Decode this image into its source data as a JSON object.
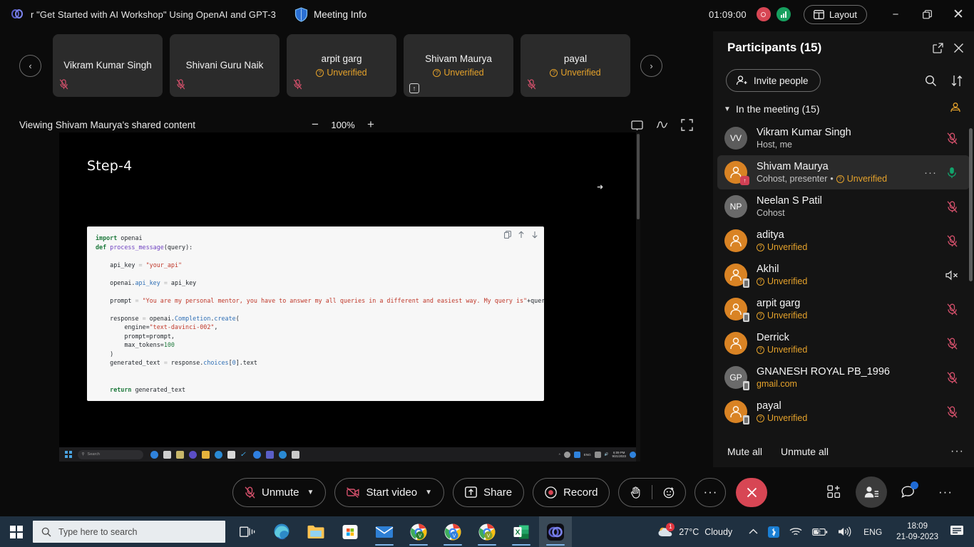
{
  "titlebar": {
    "meeting_title": "r \"Get Started with AI Workshop\" Using OpenAI and GPT-3",
    "meeting_info_label": "Meeting Info",
    "call_timer": "01:09:00",
    "layout_label": "Layout",
    "minimize_icon": "minimize-icon",
    "restore_icon": "restore-icon",
    "close_icon": "close-icon",
    "teams_logo": "teams-logo-icon",
    "shield_icon": "shield-icon",
    "recording_icon": "recording-indicator-icon",
    "network_icon": "network-quality-icon"
  },
  "thumbnails": {
    "prev_label": "‹",
    "next_label": "›",
    "unverified_label": "Unverified",
    "tiles": [
      {
        "name": "Vikram Kumar Singh",
        "unverified": false,
        "mic_off": true,
        "sharing": false
      },
      {
        "name": "Shivani Guru Naik",
        "unverified": false,
        "mic_off": true,
        "sharing": false
      },
      {
        "name": "arpit garg",
        "unverified": true,
        "mic_off": true,
        "sharing": false
      },
      {
        "name": "Shivam Maurya",
        "unverified": true,
        "mic_off": false,
        "sharing": true
      },
      {
        "name": "payal",
        "unverified": true,
        "mic_off": true,
        "sharing": false
      }
    ]
  },
  "sharebar": {
    "viewing_label": "Viewing Shivam Maurya's shared content",
    "zoom_out": "−",
    "zoom_value": "100%",
    "zoom_in": "+",
    "pop_out_icon": "pop-out-icon",
    "annotate_icon": "annotate-icon",
    "fullscreen_icon": "fullscreen-icon"
  },
  "shared_content": {
    "slide_title": "Step-4",
    "code_lines": [
      {
        "t": "kw",
        "v": "import "
      },
      {
        "t": "pl",
        "v": "openai\n"
      },
      {
        "t": "kw",
        "v": "def "
      },
      {
        "t": "fn",
        "v": "process_message"
      },
      {
        "t": "pl",
        "v": "(query):\n\n"
      },
      {
        "t": "pl",
        "v": "    api_key "
      },
      {
        "t": "op",
        "v": "= "
      },
      {
        "t": "str",
        "v": "\"your_api\"\n\n"
      },
      {
        "t": "pl",
        "v": "    openai."
      },
      {
        "t": "prop",
        "v": "api_key "
      },
      {
        "t": "op",
        "v": "= "
      },
      {
        "t": "pl",
        "v": "api_key\n\n"
      },
      {
        "t": "pl",
        "v": "    prompt "
      },
      {
        "t": "op",
        "v": "= "
      },
      {
        "t": "str",
        "v": "\"You are my personal mentor, you have to answer my all queries in a different and easiest way. My query is\""
      },
      {
        "t": "pl",
        "v": "+query\n\n"
      },
      {
        "t": "pl",
        "v": "    response "
      },
      {
        "t": "op",
        "v": "= "
      },
      {
        "t": "pl",
        "v": "openai."
      },
      {
        "t": "prop",
        "v": "Completion"
      },
      {
        "t": "pl",
        "v": "."
      },
      {
        "t": "prop",
        "v": "create"
      },
      {
        "t": "pl",
        "v": "(\n"
      },
      {
        "t": "pl",
        "v": "        engine="
      },
      {
        "t": "str",
        "v": "\"text-davinci-002\""
      },
      {
        "t": "pl",
        "v": ",\n        prompt=prompt,\n        max_tokens="
      },
      {
        "t": "num",
        "v": "100"
      },
      {
        "t": "pl",
        "v": "\n    )\n"
      },
      {
        "t": "pl",
        "v": "    generated_text "
      },
      {
        "t": "op",
        "v": "= "
      },
      {
        "t": "pl",
        "v": "response."
      },
      {
        "t": "prop",
        "v": "choices"
      },
      {
        "t": "pl",
        "v": "["
      },
      {
        "t": "prop",
        "v": "0"
      },
      {
        "t": "pl",
        "v": "].text\n\n\n"
      },
      {
        "t": "kw",
        "v": "    return "
      },
      {
        "t": "pl",
        "v": "generated_text"
      }
    ],
    "copy_icon": "copy-icon",
    "scroll_up_icon": "arrow-up-icon",
    "scroll_down_icon": "arrow-down-icon",
    "inner_taskbar": {
      "search_placeholder": "Search",
      "clock": "6:09 PM",
      "date": "9/21/2023"
    }
  },
  "participants": {
    "title": "Participants (15)",
    "open_in_new_icon": "pop-out-icon",
    "close_icon": "close-icon",
    "invite_label": "Invite people",
    "invite_icon": "add-person-icon",
    "search_icon": "search-icon",
    "sort_icon": "sort-icon",
    "section_label": "In the meeting (15)",
    "section_chevron": "chevron-down-icon",
    "section_icon": "lobby-people-icon",
    "unverified_label": "Unverified",
    "list": [
      {
        "name": "Vikram Kumar Singh",
        "meta": "Host, me",
        "initials": "VV",
        "avatar": "initials",
        "avatar_color": "#5c5c5c",
        "unverified": false,
        "status": "mic-off",
        "badge": "none",
        "active": false
      },
      {
        "name": "Shivam Maurya",
        "meta": "Cohost, presenter",
        "initials": "",
        "avatar": "person",
        "avatar_color": "#d98324",
        "unverified": true,
        "status": "mic-on",
        "badge": "share",
        "active": true
      },
      {
        "name": "Neelan S Patil",
        "meta": "Cohost",
        "initials": "NP",
        "avatar": "initials",
        "avatar_color": "#6a6a6a",
        "unverified": false,
        "status": "mic-off",
        "badge": "none",
        "active": false
      },
      {
        "name": "aditya",
        "meta": "",
        "initials": "",
        "avatar": "person",
        "avatar_color": "#d98324",
        "unverified": true,
        "status": "mic-off",
        "badge": "none",
        "active": false
      },
      {
        "name": "Akhil",
        "meta": "",
        "initials": "",
        "avatar": "person",
        "avatar_color": "#d98324",
        "unverified": true,
        "status": "speaker-off",
        "badge": "phone",
        "active": false
      },
      {
        "name": "arpit garg",
        "meta": "",
        "initials": "",
        "avatar": "person",
        "avatar_color": "#d98324",
        "unverified": true,
        "status": "mic-off",
        "badge": "phone",
        "active": false
      },
      {
        "name": "Derrick",
        "meta": "",
        "initials": "",
        "avatar": "person",
        "avatar_color": "#d98324",
        "unverified": true,
        "status": "mic-off",
        "badge": "none",
        "active": false
      },
      {
        "name": "GNANESH ROYAL PB_1996",
        "meta": "gmail.com",
        "initials": "GP",
        "avatar": "initials",
        "avatar_color": "#6a6a6a",
        "unverified": false,
        "status": "mic-off",
        "badge": "phone",
        "active": false,
        "meta_is_domain": true
      },
      {
        "name": "payal",
        "meta": "",
        "initials": "",
        "avatar": "person",
        "avatar_color": "#d98324",
        "unverified": true,
        "status": "mic-off",
        "badge": "phone",
        "active": false
      }
    ],
    "mute_all_label": "Mute all",
    "unmute_all_label": "Unmute all",
    "more_label": "···"
  },
  "controls": {
    "unmute_label": "Unmute",
    "unmute_icon": "mic-off-icon",
    "start_video_label": "Start video",
    "start_video_icon": "camera-off-icon",
    "share_label": "Share",
    "share_icon": "share-screen-icon",
    "record_label": "Record",
    "record_icon": "record-icon",
    "raise_hand_icon": "raise-hand-icon",
    "reactions_icon": "reaction-icon",
    "more_label": "···",
    "hangup_icon": "end-call-icon",
    "apps_icon": "apps-add-icon",
    "people_icon": "people-icon",
    "chat_icon": "chat-icon",
    "overflow_label": "···"
  },
  "taskbar": {
    "start_icon": "windows-start-icon",
    "search_placeholder": "Type here to search",
    "search_icon": "search-icon",
    "task_view_icon": "task-view-icon",
    "apps": [
      {
        "name": "edge-icon",
        "color": "#2d8ac7",
        "selected": false,
        "open": false
      },
      {
        "name": "explorer-icon",
        "color": "#ffc452",
        "selected": false,
        "open": false
      },
      {
        "name": "store-icon",
        "color": "#ffffff",
        "selected": false,
        "open": false
      },
      {
        "name": "mail-icon",
        "color": "#2e7fd4",
        "selected": false,
        "open": true
      },
      {
        "name": "chrome-icon-1",
        "color": "#4caf50",
        "selected": false,
        "open": true
      },
      {
        "name": "chrome-icon-2",
        "color": "#2f7fe0",
        "selected": false,
        "open": true
      },
      {
        "name": "chrome-icon-3",
        "color": "#4caf50",
        "selected": false,
        "open": true
      },
      {
        "name": "excel-icon",
        "color": "#1d6f42",
        "selected": false,
        "open": true
      },
      {
        "name": "teams-icon",
        "color": "#5b5fc7",
        "selected": true,
        "open": true
      }
    ],
    "weather_temp": "27°C",
    "weather_desc": "Cloudy",
    "weather_badge": "1",
    "chevron_icon": "show-hidden-icons-icon",
    "bluetooth_icon": "bluetooth-icon",
    "wifi_icon": "wifi-icon",
    "battery_icon": "battery-charging-icon",
    "volume_icon": "volume-icon",
    "language": "ENG",
    "clock_time": "18:09",
    "clock_date": "21-09-2023",
    "notification_icon": "notification-icon"
  }
}
